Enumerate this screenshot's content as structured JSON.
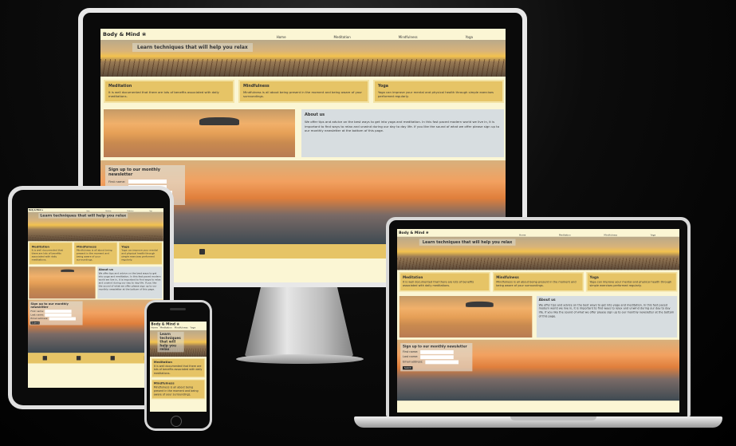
{
  "site": {
    "brand": "Body & Mind",
    "nav": [
      "Home",
      "Meditation",
      "Mindfulness",
      "Yoga"
    ],
    "hero_title": "Learn techniques that will help you relax",
    "cards": [
      {
        "title": "Meditation",
        "text": "It is well documented that there are lots of benefits associated with daily meditations."
      },
      {
        "title": "Mindfulness",
        "text": "Mindfulness is all about being present in the moment and being aware of your surroundings."
      },
      {
        "title": "Yoga",
        "text": "Yoga can improve your mental and physical health through simple exercises performed regularly."
      }
    ],
    "about": {
      "title": "About us",
      "text": "We offer tips and advice on the best ways to get into yoga and meditation. In this fast paced modern world we live in, it is important to find ways to relax and unwind during our day to day life. If you like the sound of what we offer please sign up to our monthly newsletter at the bottom of this page."
    },
    "signup": {
      "title": "Sign up to our monthly newsletter",
      "fields": [
        "First name:",
        "Last name:",
        "Email address:"
      ],
      "button": "Submit"
    }
  },
  "colors": {
    "accent": "#e6c466",
    "background": "#fbf6d4"
  },
  "footer_icons": [
    "facebook-icon",
    "twitter-icon",
    "instagram-icon",
    "youtube-icon"
  ]
}
